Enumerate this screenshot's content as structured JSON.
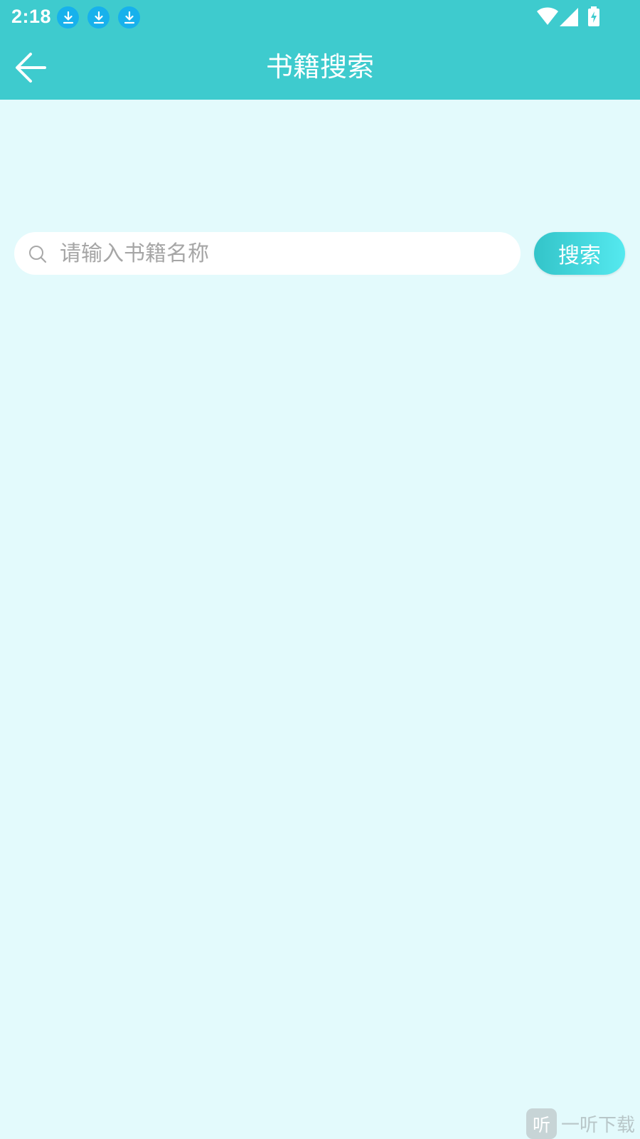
{
  "status_bar": {
    "time": "2:18",
    "notification_icons": [
      "download-icon",
      "download-icon",
      "download-icon"
    ],
    "right_icons": [
      "wifi-icon",
      "cell-signal-icon",
      "battery-charging-icon"
    ],
    "download_icon_color": "#17b1ec"
  },
  "app_bar": {
    "title": "书籍搜索",
    "back_icon": "arrow-left-icon",
    "background_color": "#3ecbce"
  },
  "search": {
    "placeholder": "请输入书籍名称",
    "value": "",
    "button_label": "搜索",
    "icon": "search-icon"
  },
  "watermark": {
    "logo_char": "听",
    "text": "一听下载"
  },
  "colors": {
    "page_background": "#e3fafc",
    "accent": "#3ecbce"
  }
}
